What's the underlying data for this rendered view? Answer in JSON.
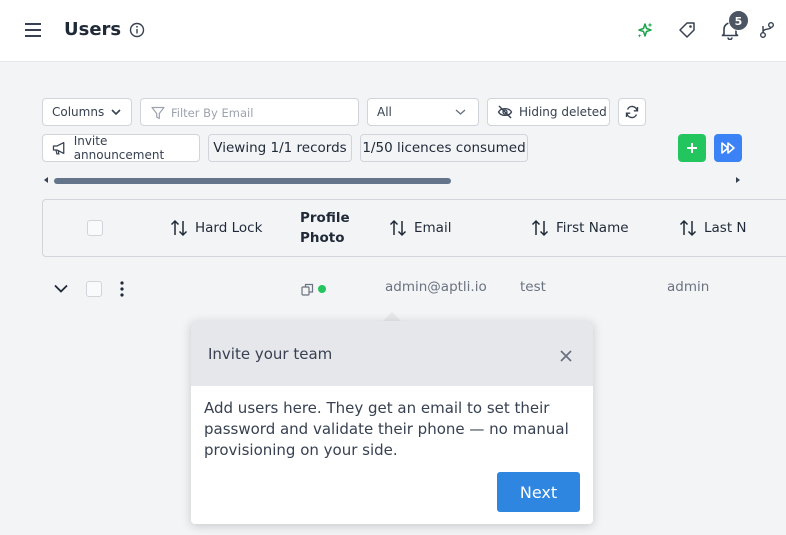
{
  "header": {
    "title": "Users",
    "notification_count": "5"
  },
  "toolbar": {
    "columns_label": "Columns",
    "filter_placeholder": "Filter By Email",
    "status_select_value": "All",
    "hiding_deleted_label": "Hiding deleted",
    "invite_label": "Invite announcement",
    "viewing_label": "Viewing 1/1 records",
    "licences_label": "1/50 licences consumed"
  },
  "table": {
    "columns": {
      "hard_lock": "Hard Lock",
      "profile_photo_line1": "Profile",
      "profile_photo_line2": "Photo",
      "email": "Email",
      "first_name": "First Name",
      "last_name": "Last N"
    },
    "rows": [
      {
        "email": "admin@aptli.io",
        "first_name": "test",
        "last_name": "admin",
        "online": true
      }
    ]
  },
  "popover": {
    "title": "Invite your team",
    "body": "Add users here. They get an email to set their password and validate their phone — no manual provisioning on your side.",
    "next_label": "Next"
  },
  "colors": {
    "accent_green": "#22c55e",
    "accent_blue": "#3b82f6",
    "next_button": "#2f86e0",
    "online_dot": "#22c55e"
  },
  "icons": [
    "menu-icon",
    "info-icon",
    "sparkle-icon",
    "tag-icon",
    "bell-icon",
    "branch-icon",
    "filter-icon",
    "eye-off-icon",
    "refresh-icon",
    "megaphone-icon",
    "plus-icon",
    "fast-forward-icon",
    "sort-icon",
    "chevron-down-icon",
    "kebab-icon",
    "copy-icon",
    "close-icon"
  ]
}
